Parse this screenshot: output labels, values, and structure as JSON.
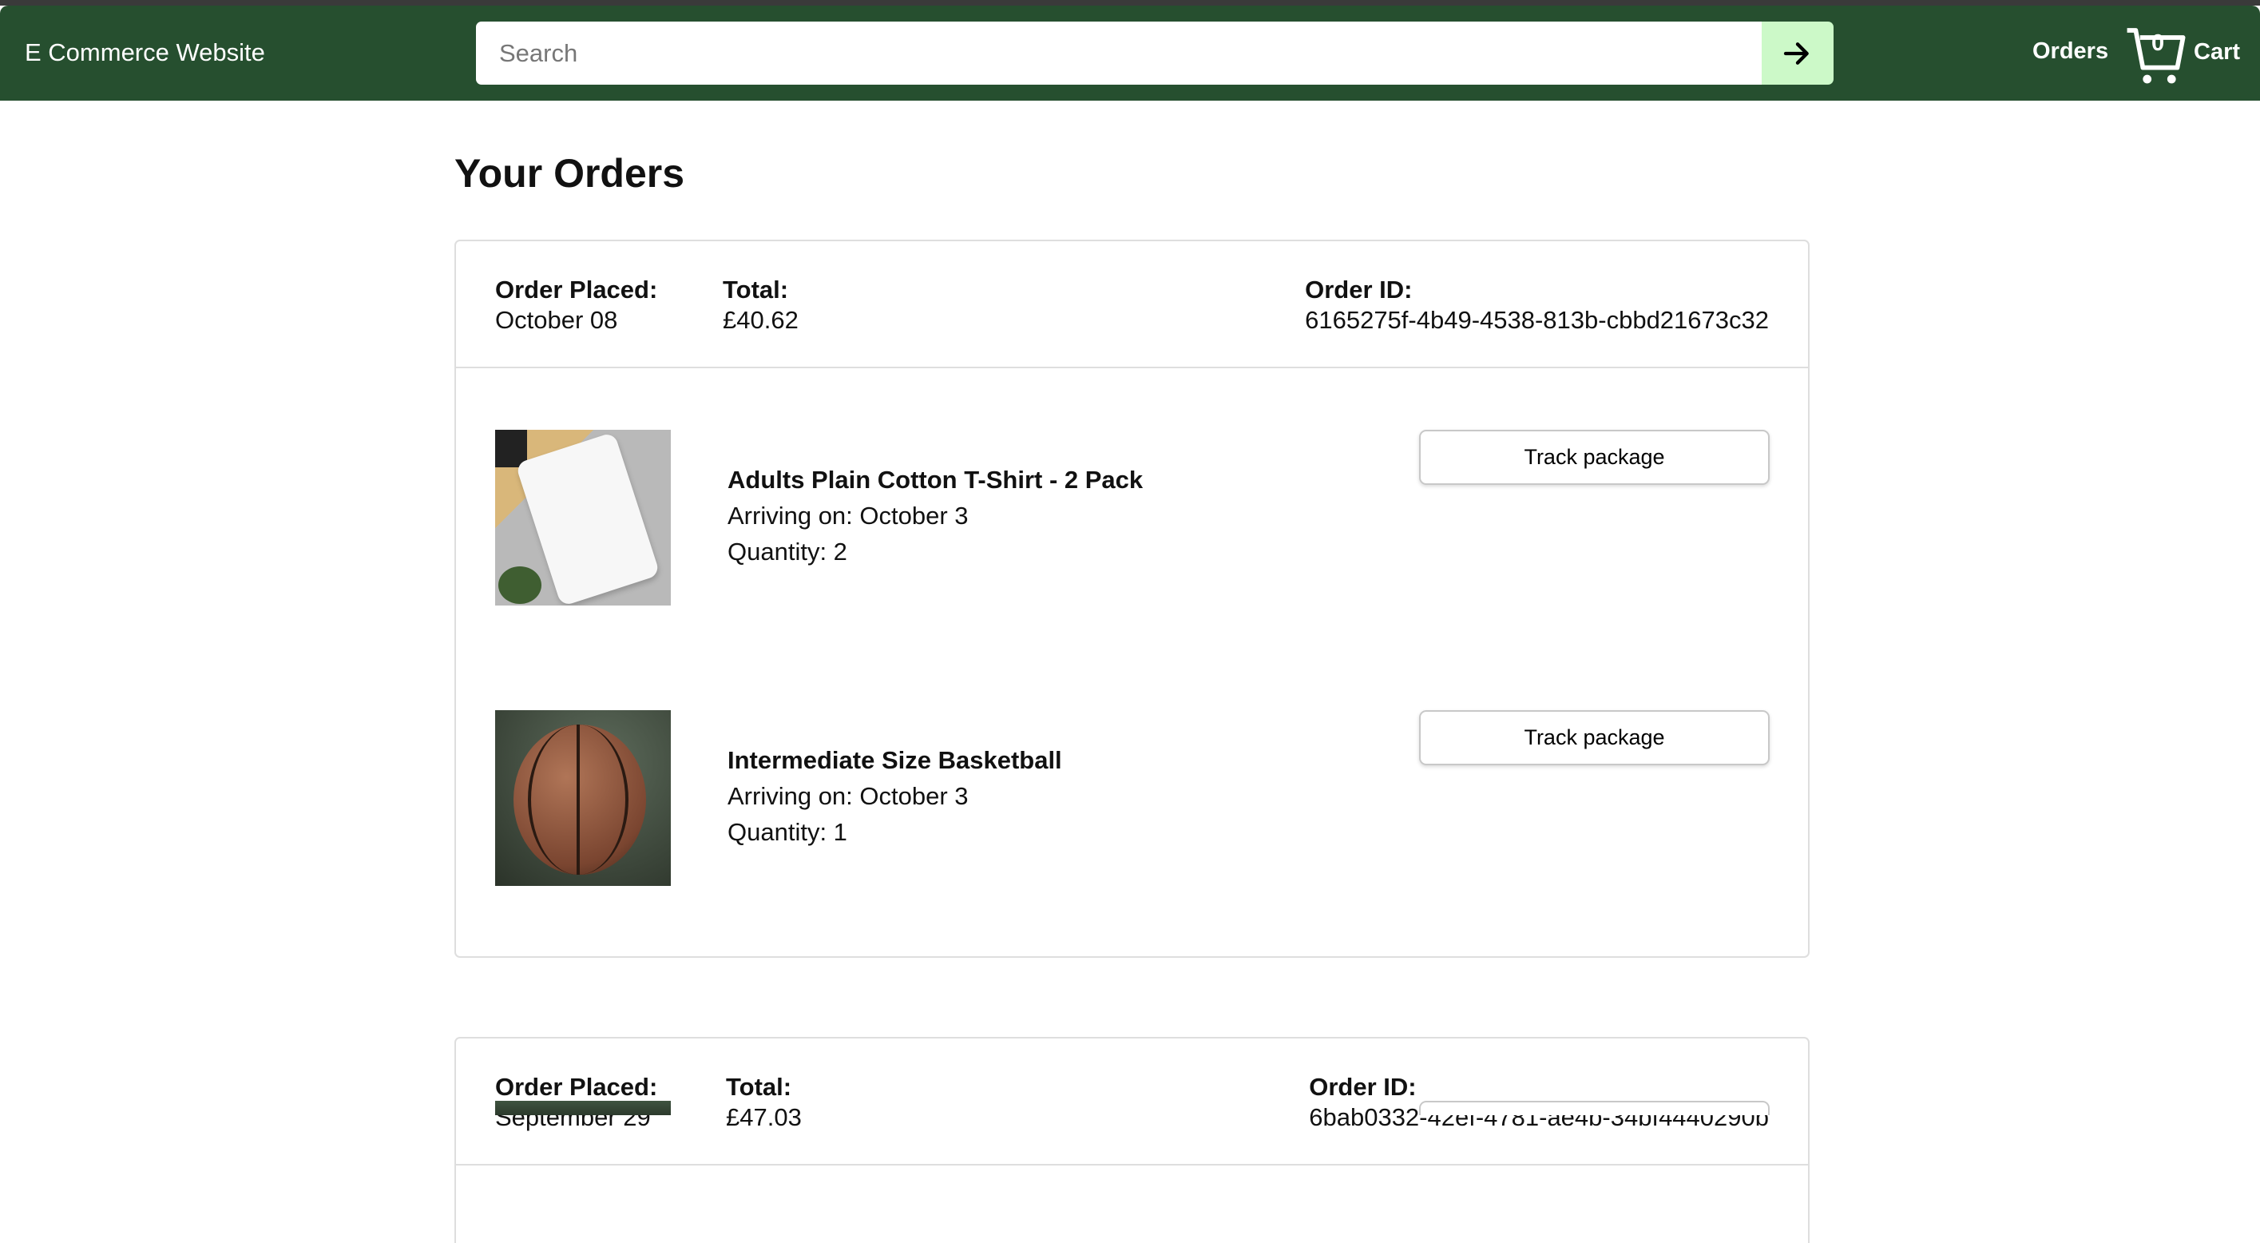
{
  "header": {
    "brand": "E Commerce Website",
    "search_placeholder": "Search",
    "search_value": "",
    "orders_label": "Orders",
    "cart_count": "0",
    "cart_label": "Cart",
    "accent_color": "#264f2f",
    "search_button_color": "#ccf9c8"
  },
  "page_title": "Your Orders",
  "labels": {
    "order_placed": "Order Placed:",
    "total": "Total:",
    "order_id": "Order ID:",
    "arriving_prefix": "Arriving on: ",
    "quantity_prefix": "Quantity: ",
    "track": "Track package"
  },
  "orders": [
    {
      "placed": "October 08",
      "total": "£40.62",
      "id": "6165275f-4b49-4538-813b-cbbd21673c32",
      "items": [
        {
          "name": "Adults Plain Cotton T-Shirt - 2 Pack",
          "arriving": "Arriving on: October 3",
          "quantity": "Quantity: 2",
          "image": "t-shirt-photo"
        },
        {
          "name": "Intermediate Size Basketball",
          "arriving": "Arriving on: October 3",
          "quantity": "Quantity: 1",
          "image": "basketball-photo"
        }
      ]
    },
    {
      "placed": "September 29",
      "total": "£47.03",
      "id": "6bab0332-42ef-4781-ae4b-34bf4440290b",
      "items": []
    }
  ]
}
